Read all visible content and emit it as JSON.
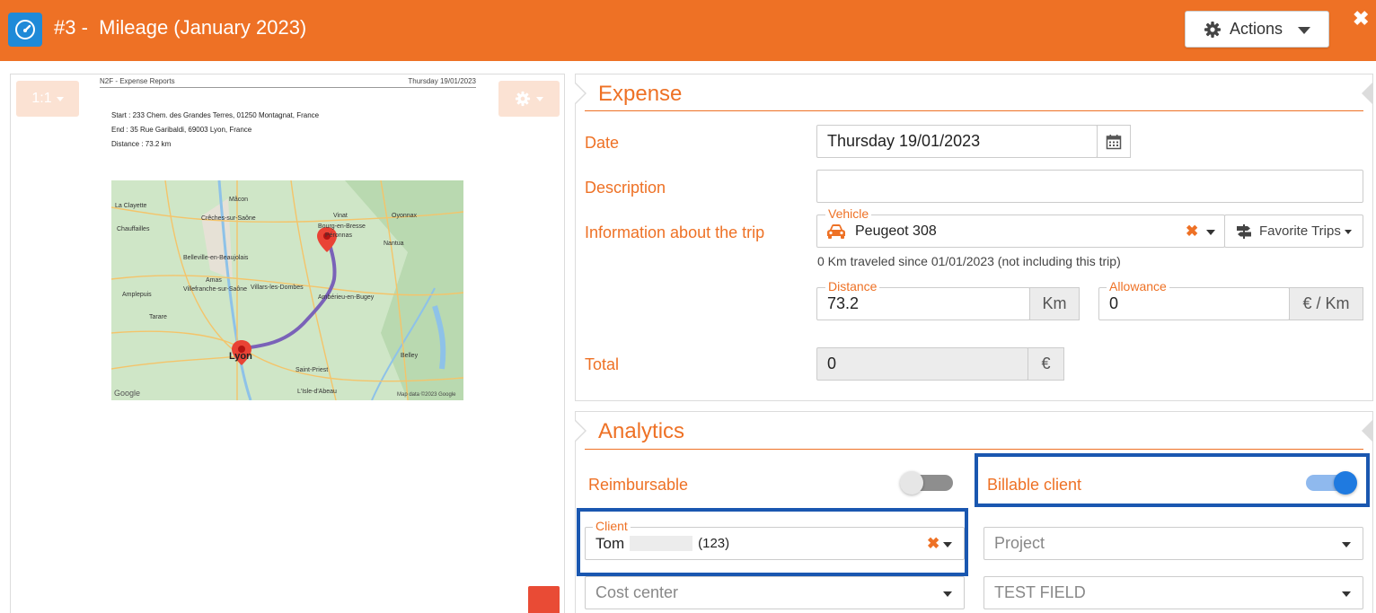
{
  "window": {
    "title": "#3 -  Mileage (January 2023)",
    "actions_label": "Actions",
    "close_glyph": "✖"
  },
  "preview": {
    "zoom_label": "1:1",
    "doc_app": "N2F - Expense Reports",
    "doc_date": "Thursday 19/01/2023",
    "start_line": "Start : 233 Chem. des Grandes Terres, 01250 Montagnat, France",
    "end_line": "End : 35 Rue Garibaldi, 69003 Lyon, France",
    "distance_line": "Distance : 73.2 km",
    "map_labels": [
      "Mâcon",
      "La Clayette",
      "Chauffailles",
      "Crêches-sur-Saône",
      "Belleville-en-Beaujolais",
      "Amas",
      "Villefranche-sur-Saône",
      "Villars-les-Dombes",
      "Amplepuis",
      "Tarare",
      "Lyon",
      "Saint-Priest",
      "Vinat",
      "Bourg-en-Bresse",
      "Péronnas",
      "Oyonnax",
      "Nantua",
      "Ambérieu-en-Bugey",
      "Belley",
      "L'Isle-d'Abeau",
      "Google",
      "Map data ©2023 Google"
    ]
  },
  "expense": {
    "section_title": "Expense",
    "date_label": "Date",
    "date_value": "Thursday 19/01/2023",
    "description_label": "Description",
    "description_value": "",
    "trip_label": "Information about the trip",
    "vehicle_label": "Vehicle",
    "vehicle_value": "Peugeot 308",
    "favorite_trips_label": "Favorite Trips",
    "km_hint": "0 Km traveled since 01/01/2023 (not including this trip)",
    "distance_label": "Distance",
    "distance_value": "73.2",
    "distance_unit": "Km",
    "allowance_label": "Allowance",
    "allowance_value": "0",
    "allowance_unit": "€ / Km",
    "total_label": "Total",
    "total_value": "0",
    "total_unit": "€"
  },
  "analytics": {
    "section_title": "Analytics",
    "reimbursable_label": "Reimbursable",
    "reimbursable_on": false,
    "billable_label": "Billable client",
    "billable_on": true,
    "client_label": "Client",
    "client_name": "Tom",
    "client_code": "(123)",
    "project_placeholder": "Project",
    "cost_center_placeholder": "Cost center",
    "test_field_placeholder": "TEST FIELD"
  },
  "colors": {
    "accent": "#ee7125",
    "highlight": "#1a57b0",
    "toggle_on": "#1f7ae0",
    "app_icon": "#1f8ad8"
  }
}
